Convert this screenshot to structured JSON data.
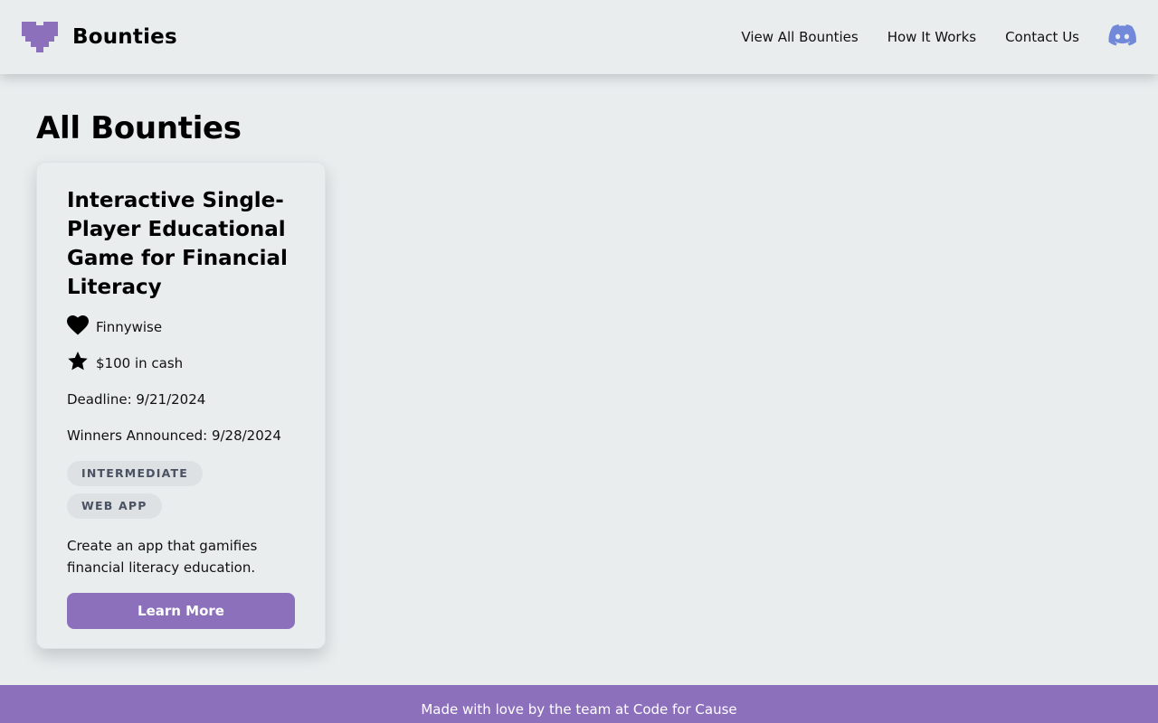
{
  "header": {
    "brand_title": "Bounties",
    "logo_icon": "pixel-heart-icon",
    "nav": [
      {
        "label": "View All Bounties"
      },
      {
        "label": "How It Works"
      },
      {
        "label": "Contact Us"
      }
    ],
    "discord_icon": "discord-icon"
  },
  "main": {
    "page_title": "All Bounties",
    "cards": [
      {
        "title": "Interactive Single-Player Educational Game for Financial Literacy",
        "organization": "Finnywise",
        "reward": "$100 in cash",
        "deadline": "Deadline: 9/21/2024",
        "winners": "Winners Announced: 9/28/2024",
        "tags": [
          "INTERMEDIATE",
          "WEB APP"
        ],
        "description": "Create an app that gamifies financial literacy education.",
        "button_label": "Learn More"
      }
    ]
  },
  "footer": {
    "text": "Made with love by the team at Code for Cause"
  },
  "colors": {
    "accent": "#8c70bc",
    "background": "#e9edee",
    "discord": "#7289da"
  }
}
